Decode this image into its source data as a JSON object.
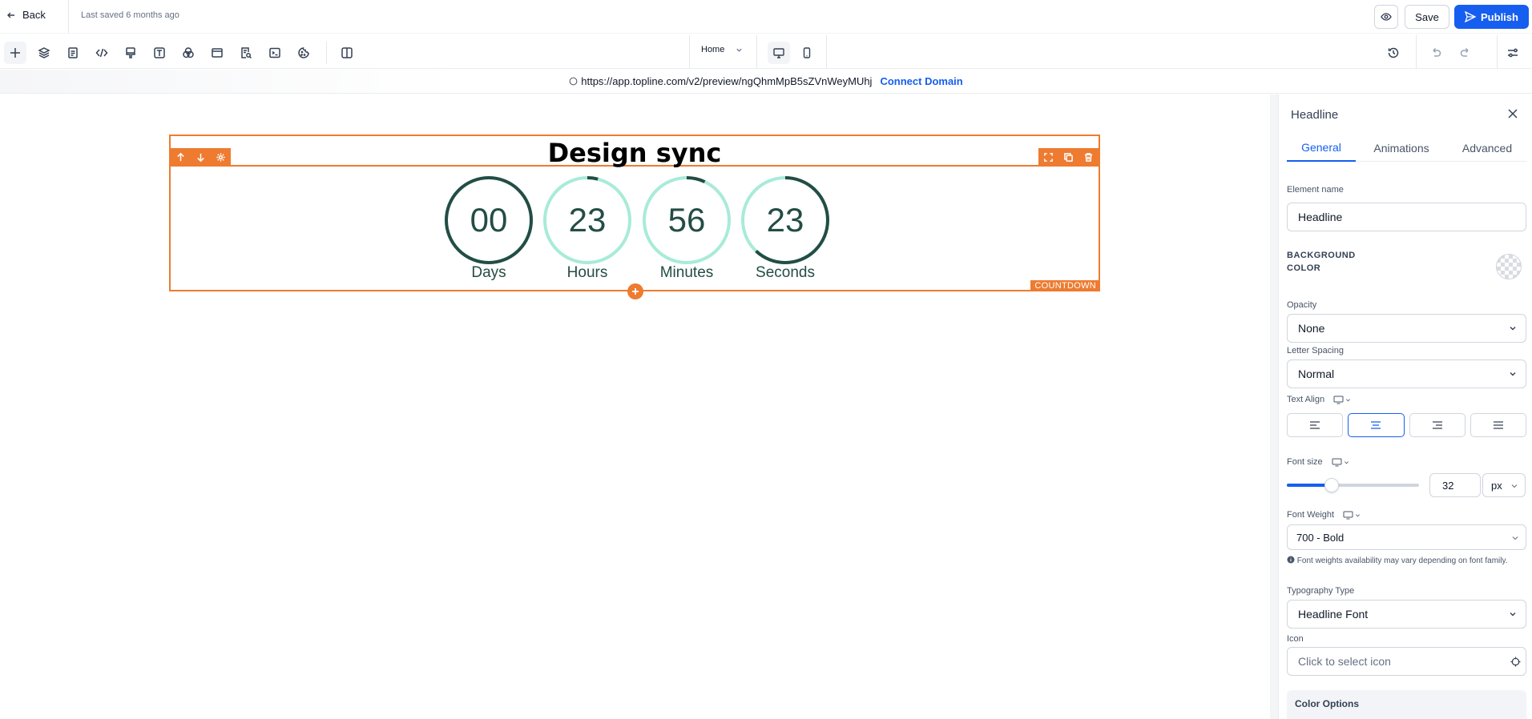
{
  "topbar": {
    "back_label": "Back",
    "saved_text": "Last saved 6 months ago",
    "save_label": "Save",
    "publish_label": "Publish"
  },
  "toolbar": {
    "page_select": "Home"
  },
  "urlbar": {
    "url": "https://app.topline.com/v2/preview/ngQhmMpB5sZVnWeyMUhj",
    "connect_label": "Connect Domain"
  },
  "canvas": {
    "headline": "Design sync",
    "countdown_tag": "COUNTDOWN",
    "timers": [
      {
        "value": "00",
        "label": "Days",
        "progress": 1.0
      },
      {
        "value": "23",
        "label": "Hours",
        "progress": 0.04
      },
      {
        "value": "56",
        "label": "Minutes",
        "progress": 0.07
      },
      {
        "value": "23",
        "label": "Seconds",
        "progress": 0.62
      }
    ],
    "colors": {
      "accent": "#ee7b30",
      "ring_dark": "#234d45",
      "ring_light": "#a8ebd8"
    }
  },
  "panel": {
    "title": "Headline",
    "tabs": [
      "General",
      "Animations",
      "Advanced"
    ],
    "element_name_label": "Element name",
    "element_name_value": "Headline",
    "bg_color_label_1": "BACKGROUND",
    "bg_color_label_2": "COLOR",
    "opacity_label": "Opacity",
    "opacity_value": "None",
    "letter_spacing_label": "Letter Spacing",
    "letter_spacing_value": "Normal",
    "text_align_label": "Text Align",
    "font_size_label": "Font size",
    "font_size_value": "32",
    "font_size_unit": "px",
    "font_weight_label": "Font Weight",
    "font_weight_value": "700 - Bold",
    "font_note": "Font weights availability may vary depending on font family.",
    "typography_label": "Typography Type",
    "typography_value": "Headline Font",
    "icon_label": "Icon",
    "icon_placeholder": "Click to select icon",
    "color_options_label": "Color Options",
    "accent": "#155eef"
  }
}
